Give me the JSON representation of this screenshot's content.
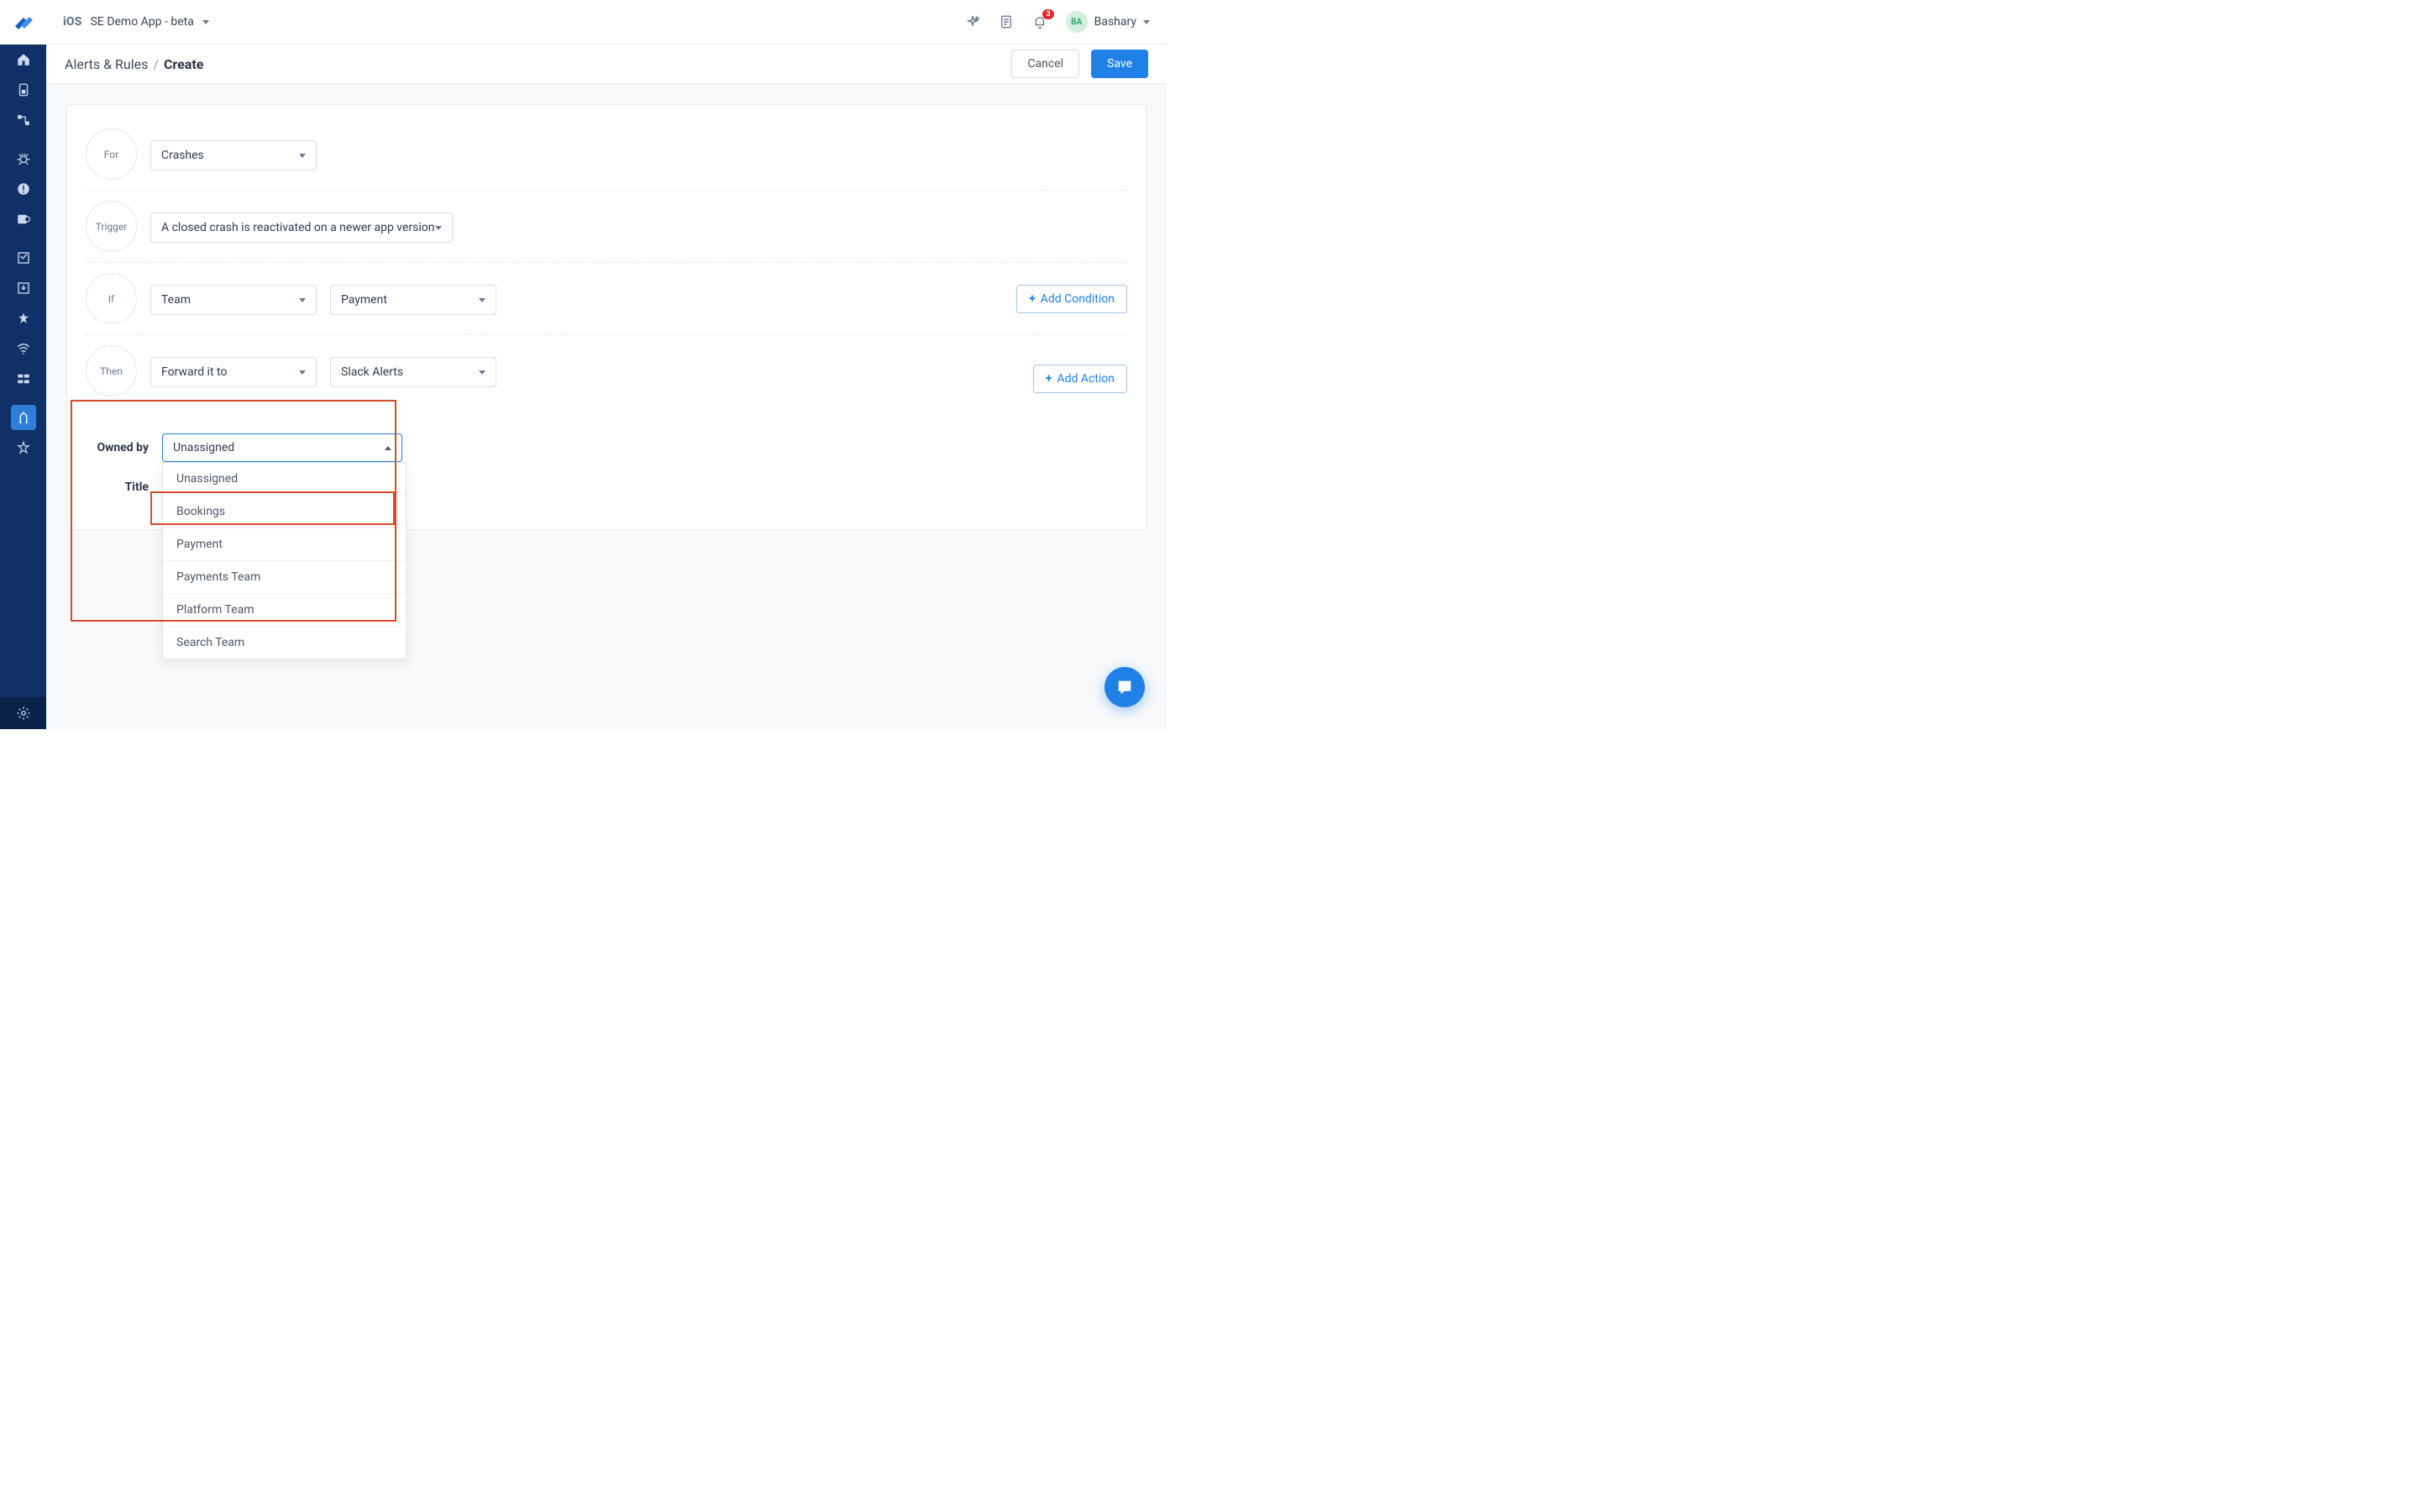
{
  "sidebar": {
    "items": [
      {
        "name": "home-icon"
      },
      {
        "name": "battery-icon"
      },
      {
        "name": "flows-icon"
      },
      {
        "name": "bug-icon"
      },
      {
        "name": "alerts-icon"
      },
      {
        "name": "snooze-icon"
      },
      {
        "name": "survey-icon"
      },
      {
        "name": "download-icon"
      },
      {
        "name": "app-ratings-icon"
      },
      {
        "name": "wifi-icon"
      },
      {
        "name": "integrations-icon"
      },
      {
        "name": "rules-icon"
      },
      {
        "name": "debug-icon"
      }
    ]
  },
  "topbar": {
    "platform": "iOS",
    "app_name": "SE Demo App - beta",
    "notif_count": "3",
    "user_initials": "BA",
    "user_name": "Bashary"
  },
  "breadcrumb": {
    "parent": "Alerts & Rules",
    "current": "Create"
  },
  "header_actions": {
    "cancel": "Cancel",
    "save": "Save"
  },
  "rule": {
    "for": {
      "label": "For",
      "value": "Crashes"
    },
    "trigger": {
      "label": "Trigger",
      "value": "A closed crash is reactivated on a newer app version"
    },
    "if": {
      "label": "If",
      "field": "Team",
      "value": "Payment",
      "add": "Add Condition"
    },
    "then": {
      "label": "Then",
      "field": "Forward it to",
      "value": "Slack Alerts",
      "add": "Add Action"
    }
  },
  "owned": {
    "label": "Owned by",
    "selected": "Unassigned",
    "options": [
      "Unassigned",
      "Bookings",
      "Payment",
      "Payments Team",
      "Platform Team",
      "Search Team"
    ]
  },
  "title": {
    "label": "Title"
  }
}
